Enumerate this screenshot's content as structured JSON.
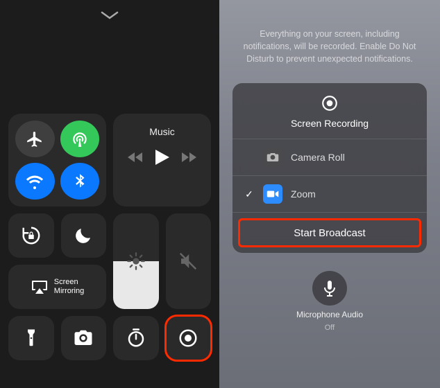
{
  "left": {
    "music_label": "Music",
    "screen_mirroring_label": "Screen\nMirroring"
  },
  "right": {
    "info_text": "Everything on your screen, including notifications, will be recorded. Enable Do Not Disturb to prevent unexpected notifications.",
    "sheet_title": "Screen Recording",
    "apps": {
      "camera_roll": {
        "label": "Camera Roll",
        "selected": false
      },
      "zoom": {
        "label": "Zoom",
        "selected": true
      }
    },
    "start_label": "Start Broadcast",
    "mic": {
      "label": "Microphone Audio",
      "state": "Off"
    }
  }
}
